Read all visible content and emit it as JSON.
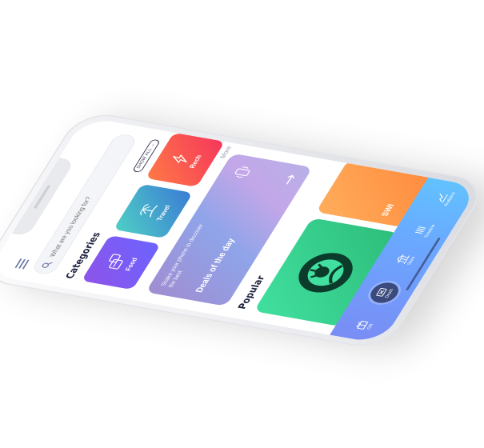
{
  "search": {
    "placeholder": "What are you looking for?"
  },
  "categories": {
    "title": "Categories",
    "show_all_label": "SHOW ALL →",
    "items": [
      {
        "label": "Food",
        "icon": "food-icon"
      },
      {
        "label": "Travel",
        "icon": "island-icon"
      },
      {
        "label": "Rech",
        "icon": "bolt-icon"
      }
    ],
    "more_label": "More"
  },
  "deals": {
    "subtitle": "Shake your phone to discover the best",
    "title": "Deals of the day"
  },
  "popular": {
    "title": "Popular",
    "items": [
      {
        "label": "",
        "brand": "starbucks"
      },
      {
        "label": "SWI",
        "brand": "swiggy"
      }
    ]
  },
  "tabbar": {
    "items": [
      {
        "label": "Gift",
        "icon": "gift-icon",
        "active": false
      },
      {
        "label": "Deals",
        "icon": "ticket-icon",
        "active": true
      },
      {
        "label": "Store",
        "icon": "store-icon",
        "active": false
      },
      {
        "label": "Timeline",
        "icon": "timeline-icon",
        "active": false
      },
      {
        "label": "Analytics",
        "icon": "analytics-icon",
        "active": false
      }
    ]
  },
  "colors": {
    "tabbar_gradient": [
      "#7a8df5",
      "#62c2ff"
    ],
    "food": "#8e54e9",
    "travel": "#4fd1c5",
    "recharge": "#f5365c",
    "starbucks": "#41e0a0",
    "swiggy": "#ff8a3d"
  }
}
